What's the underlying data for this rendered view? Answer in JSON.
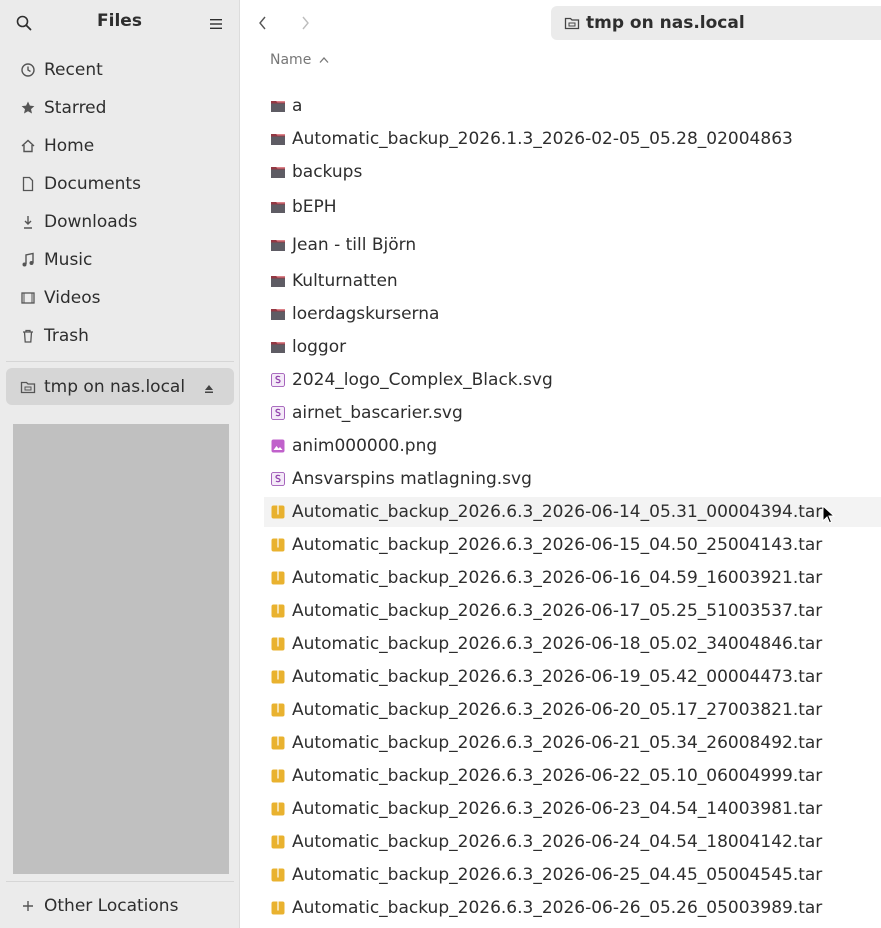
{
  "sidebar": {
    "title": "Files",
    "search_icon": "search-icon",
    "menu_icon": "menu-icon",
    "items": [
      {
        "label": "Recent",
        "icon": "clock-icon"
      },
      {
        "label": "Starred",
        "icon": "star-icon"
      },
      {
        "label": "Home",
        "icon": "home-icon"
      },
      {
        "label": "Documents",
        "icon": "document-icon"
      },
      {
        "label": "Downloads",
        "icon": "download-icon"
      },
      {
        "label": "Music",
        "icon": "music-icon"
      },
      {
        "label": "Videos",
        "icon": "video-icon"
      },
      {
        "label": "Trash",
        "icon": "trash-icon"
      }
    ],
    "mount": {
      "label": "tmp on nas.local",
      "icon": "network-folder-icon",
      "eject_icon": "eject-icon"
    },
    "other_locations": {
      "label": "Other Locations",
      "icon": "plus-icon"
    }
  },
  "toolbar": {
    "back_icon": "chevron-left-icon",
    "forward_icon": "chevron-right-icon",
    "path": "tmp on nas.local"
  },
  "column_header": {
    "name": "Name",
    "sort_icon": "sort-up-icon"
  },
  "files": [
    {
      "name": "a",
      "type": "folder"
    },
    {
      "name": "Automatic_backup_2026.1.3_2026-02-05_05.28_02004863",
      "type": "folder"
    },
    {
      "name": "backups",
      "type": "folder"
    },
    {
      "name": "bEPH",
      "type": "folder"
    },
    {
      "name": "Jean - till Björn",
      "type": "folder"
    },
    {
      "name": "Kulturnatten",
      "type": "folder"
    },
    {
      "name": "loerdagskurserna",
      "type": "folder"
    },
    {
      "name": "loggor",
      "type": "folder"
    },
    {
      "name": "2024_logo_Complex_Black.svg",
      "type": "svg"
    },
    {
      "name": "airnet_bascarier.svg",
      "type": "svg"
    },
    {
      "name": "anim000000.png",
      "type": "image"
    },
    {
      "name": "Ansvarspins matlagning.svg",
      "type": "svg"
    },
    {
      "name": "Automatic_backup_2026.6.3_2026-06-14_05.31_00004394.tar",
      "type": "archive"
    },
    {
      "name": "Automatic_backup_2026.6.3_2026-06-15_04.50_25004143.tar",
      "type": "archive"
    },
    {
      "name": "Automatic_backup_2026.6.3_2026-06-16_04.59_16003921.tar",
      "type": "archive"
    },
    {
      "name": "Automatic_backup_2026.6.3_2026-06-17_05.25_51003537.tar",
      "type": "archive"
    },
    {
      "name": "Automatic_backup_2026.6.3_2026-06-18_05.02_34004846.tar",
      "type": "archive"
    },
    {
      "name": "Automatic_backup_2026.6.3_2026-06-19_05.42_00004473.tar",
      "type": "archive"
    },
    {
      "name": "Automatic_backup_2026.6.3_2026-06-20_05.17_27003821.tar",
      "type": "archive"
    },
    {
      "name": "Automatic_backup_2026.6.3_2026-06-21_05.34_26008492.tar",
      "type": "archive"
    },
    {
      "name": "Automatic_backup_2026.6.3_2026-06-22_05.10_06004999.tar",
      "type": "archive"
    },
    {
      "name": "Automatic_backup_2026.6.3_2026-06-23_04.54_14003981.tar",
      "type": "archive"
    },
    {
      "name": "Automatic_backup_2026.6.3_2026-06-24_04.54_18004142.tar",
      "type": "archive"
    },
    {
      "name": "Automatic_backup_2026.6.3_2026-06-25_04.45_05004545.tar",
      "type": "archive"
    },
    {
      "name": "Automatic_backup_2026.6.3_2026-06-26_05.26_05003989.tar",
      "type": "archive"
    }
  ],
  "colors": {
    "folder": "#5e5c64",
    "folder_tab": "#c01c28",
    "archive": "#e5a50a",
    "svg": "#9141ac",
    "image": "#c061cb"
  }
}
